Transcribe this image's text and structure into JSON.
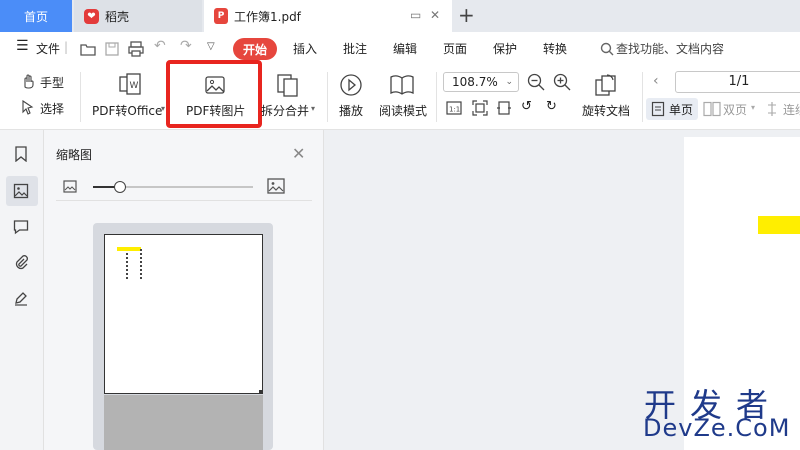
{
  "tabs": {
    "home": "首页",
    "daoke": "稻壳",
    "doc": "工作簿1.pdf",
    "add": "+"
  },
  "menu": {
    "file": "文件",
    "start": "开始",
    "insert": "插入",
    "annotate": "批注",
    "edit": "编辑",
    "page": "页面",
    "protect": "保护",
    "convert": "转换",
    "search_placeholder": "查找功能、文档内容"
  },
  "ribbon": {
    "hand": "手型",
    "select": "选择",
    "pdf_to_office": "PDF转Office",
    "pdf_to_image": "PDF转图片",
    "split_merge": "拆分合并",
    "play": "播放",
    "reading_mode": "阅读模式",
    "zoom": "108.7%",
    "rotate_doc": "旋转文档",
    "page_indicator": "1/1",
    "single_page": "单页",
    "double_page": "双页",
    "continuous": "连续"
  },
  "thumbnail_panel": {
    "title": "缩略图"
  },
  "watermark": {
    "top": "开发者",
    "bottom": "DevZe.CoM"
  },
  "colors": {
    "accent_blue": "#4b8df8",
    "start_red": "#e6463d",
    "highlight_red": "#e8251f",
    "highlight_yellow": "#ffee00",
    "watermark_blue": "#1f3a8a"
  }
}
